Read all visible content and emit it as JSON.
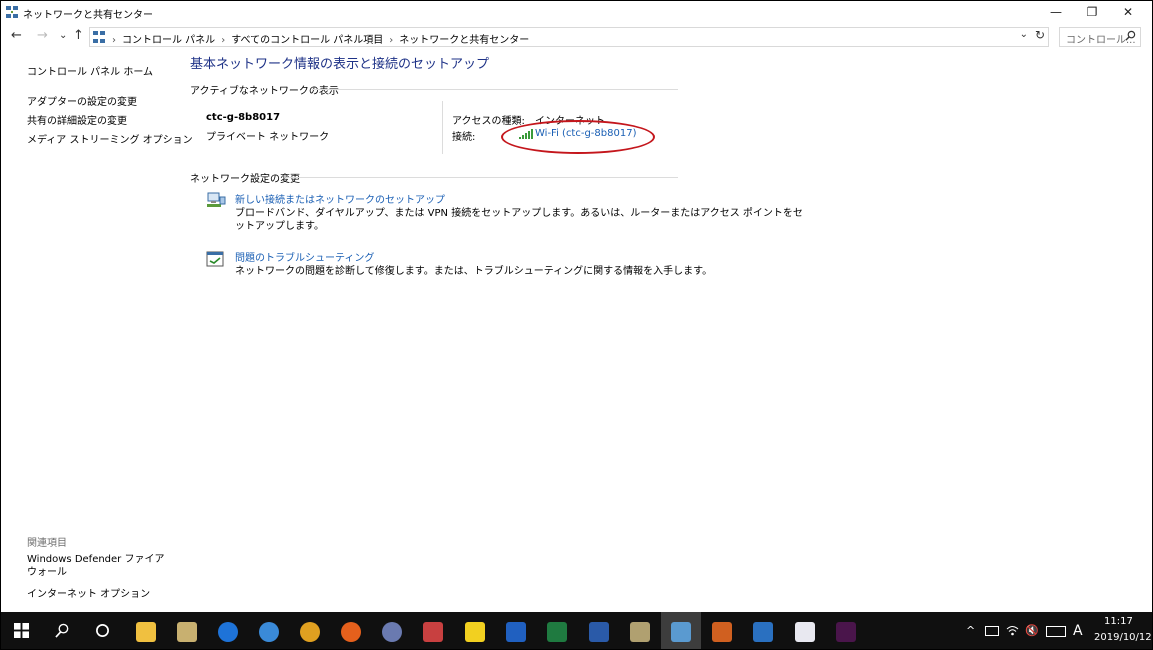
{
  "window": {
    "title": "ネットワークと共有センター",
    "min_glyph": "—",
    "max_glyph": "❐",
    "close_glyph": "✕"
  },
  "nav": {
    "back": "←",
    "forward": "→",
    "recent": "⌄",
    "up": "↑",
    "breadcrumbs": [
      "コントロール パネル",
      "すべてのコントロール パネル項目",
      "ネットワークと共有センター"
    ],
    "crumb_sep": "›",
    "search_placeholder": "コントロール..."
  },
  "left_pane": {
    "home": "コントロール パネル ホーム",
    "links": [
      "アダプターの設定の変更",
      "共有の詳細設定の変更",
      "メディア ストリーミング オプション"
    ],
    "related_title": "関連項目",
    "related_links": [
      "Windows Defender ファイアウォール",
      "インターネット オプション"
    ]
  },
  "main": {
    "title": "基本ネットワーク情報の表示と接続のセットアップ",
    "active_section": "アクティブなネットワークの表示",
    "network_name": "ctc-g-8b8017",
    "network_type": "プライベート ネットワーク",
    "access_type_label": "アクセスの種類:",
    "access_type_value": "インターネット",
    "connection_label": "接続:",
    "connection_value": "Wi-Fi (ctc-g-8b8017)",
    "change_section": "ネットワーク設定の変更",
    "tasks": [
      {
        "title": "新しい接続またはネットワークのセットアップ",
        "desc_line1": "ブロードバンド、ダイヤルアップ、または VPN 接続をセットアップします。あるいは、ルーターまたはアクセス ポイントをセ",
        "desc_line2": "ットアップします。",
        "icon": "network-setup-icon"
      },
      {
        "title": "問題のトラブルシューティング",
        "desc_line1": "ネットワークの問題を診断して修復します。または、トラブルシューティングに関する情報を入手します。",
        "desc_line2": "",
        "icon": "troubleshoot-icon"
      }
    ],
    "highlight_color": "#c4161c"
  },
  "taskbar": {
    "clock_time": "11:17",
    "clock_date": "2019/10/12",
    "ime": "A",
    "tray_chevron": "^"
  }
}
